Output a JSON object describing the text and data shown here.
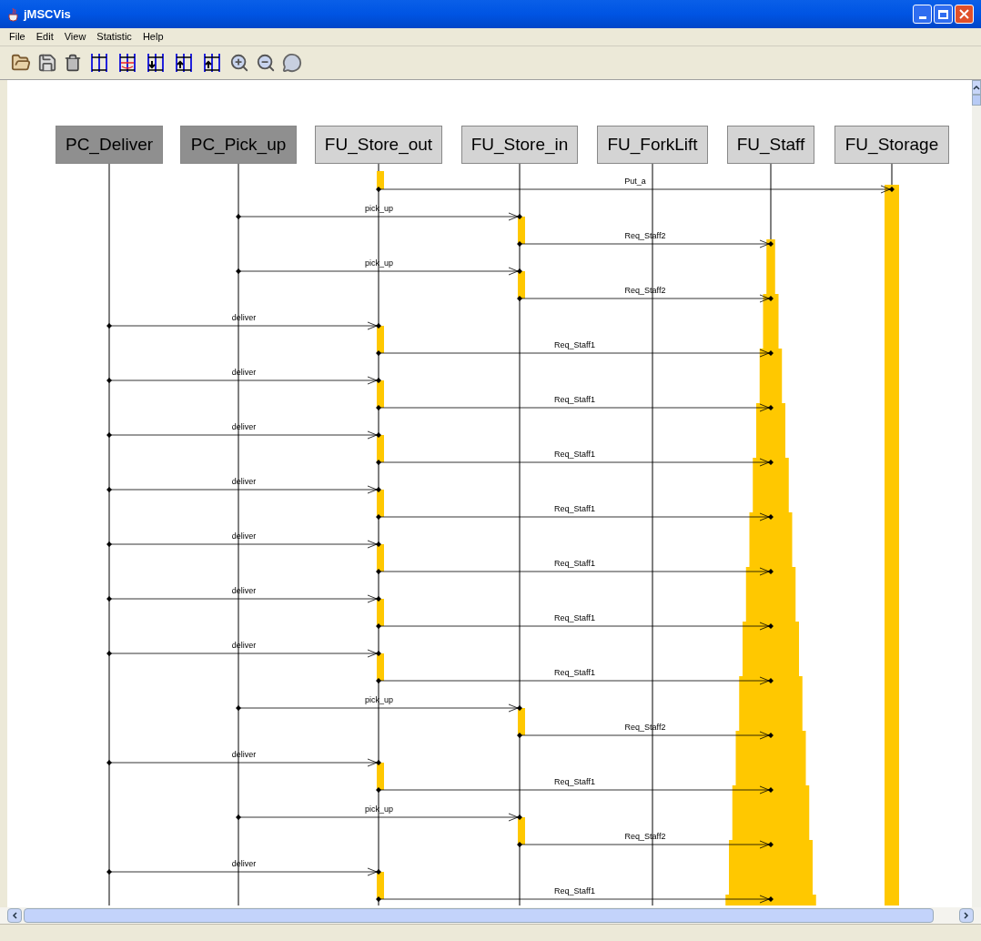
{
  "window": {
    "title": "jMSCVis"
  },
  "menu": [
    "File",
    "Edit",
    "View",
    "Statistic",
    "Help"
  ],
  "instances": [
    {
      "name": "PC_Deliver",
      "highlighted": true
    },
    {
      "name": "PC_Pick_up",
      "highlighted": true
    },
    {
      "name": "FU_Store_out",
      "highlighted": false
    },
    {
      "name": "FU_Store_in",
      "highlighted": false
    },
    {
      "name": "FU_ForkLift",
      "highlighted": false
    },
    {
      "name": "FU_Staff",
      "highlighted": false
    },
    {
      "name": "FU_Storage",
      "highlighted": false
    }
  ],
  "messages": [
    {
      "label": "Put_a",
      "kind": "store"
    },
    {
      "label": "pick_up",
      "kind": "pickup"
    },
    {
      "label": "Req_Staff2",
      "kind": "staff2"
    },
    {
      "label": "pick_up",
      "kind": "pickup"
    },
    {
      "label": "Req_Staff2",
      "kind": "staff2"
    },
    {
      "label": "deliver",
      "kind": "deliver"
    },
    {
      "label": "Req_Staff1",
      "kind": "staff1"
    },
    {
      "label": "deliver",
      "kind": "deliver"
    },
    {
      "label": "Req_Staff1",
      "kind": "staff1"
    },
    {
      "label": "deliver",
      "kind": "deliver"
    },
    {
      "label": "Req_Staff1",
      "kind": "staff1"
    },
    {
      "label": "deliver",
      "kind": "deliver"
    },
    {
      "label": "Req_Staff1",
      "kind": "staff1"
    },
    {
      "label": "deliver",
      "kind": "deliver"
    },
    {
      "label": "Req_Staff1",
      "kind": "staff1"
    },
    {
      "label": "deliver",
      "kind": "deliver"
    },
    {
      "label": "Req_Staff1",
      "kind": "staff1"
    },
    {
      "label": "deliver",
      "kind": "deliver"
    },
    {
      "label": "Req_Staff1",
      "kind": "staff1"
    },
    {
      "label": "pick_up",
      "kind": "pickup"
    },
    {
      "label": "Req_Staff2",
      "kind": "staff2"
    },
    {
      "label": "deliver",
      "kind": "deliver"
    },
    {
      "label": "Req_Staff1",
      "kind": "staff1"
    },
    {
      "label": "pick_up",
      "kind": "pickup"
    },
    {
      "label": "Req_Staff2",
      "kind": "staff2"
    },
    {
      "label": "deliver",
      "kind": "deliver"
    },
    {
      "label": "Req_Staff1",
      "kind": "staff1"
    }
  ]
}
